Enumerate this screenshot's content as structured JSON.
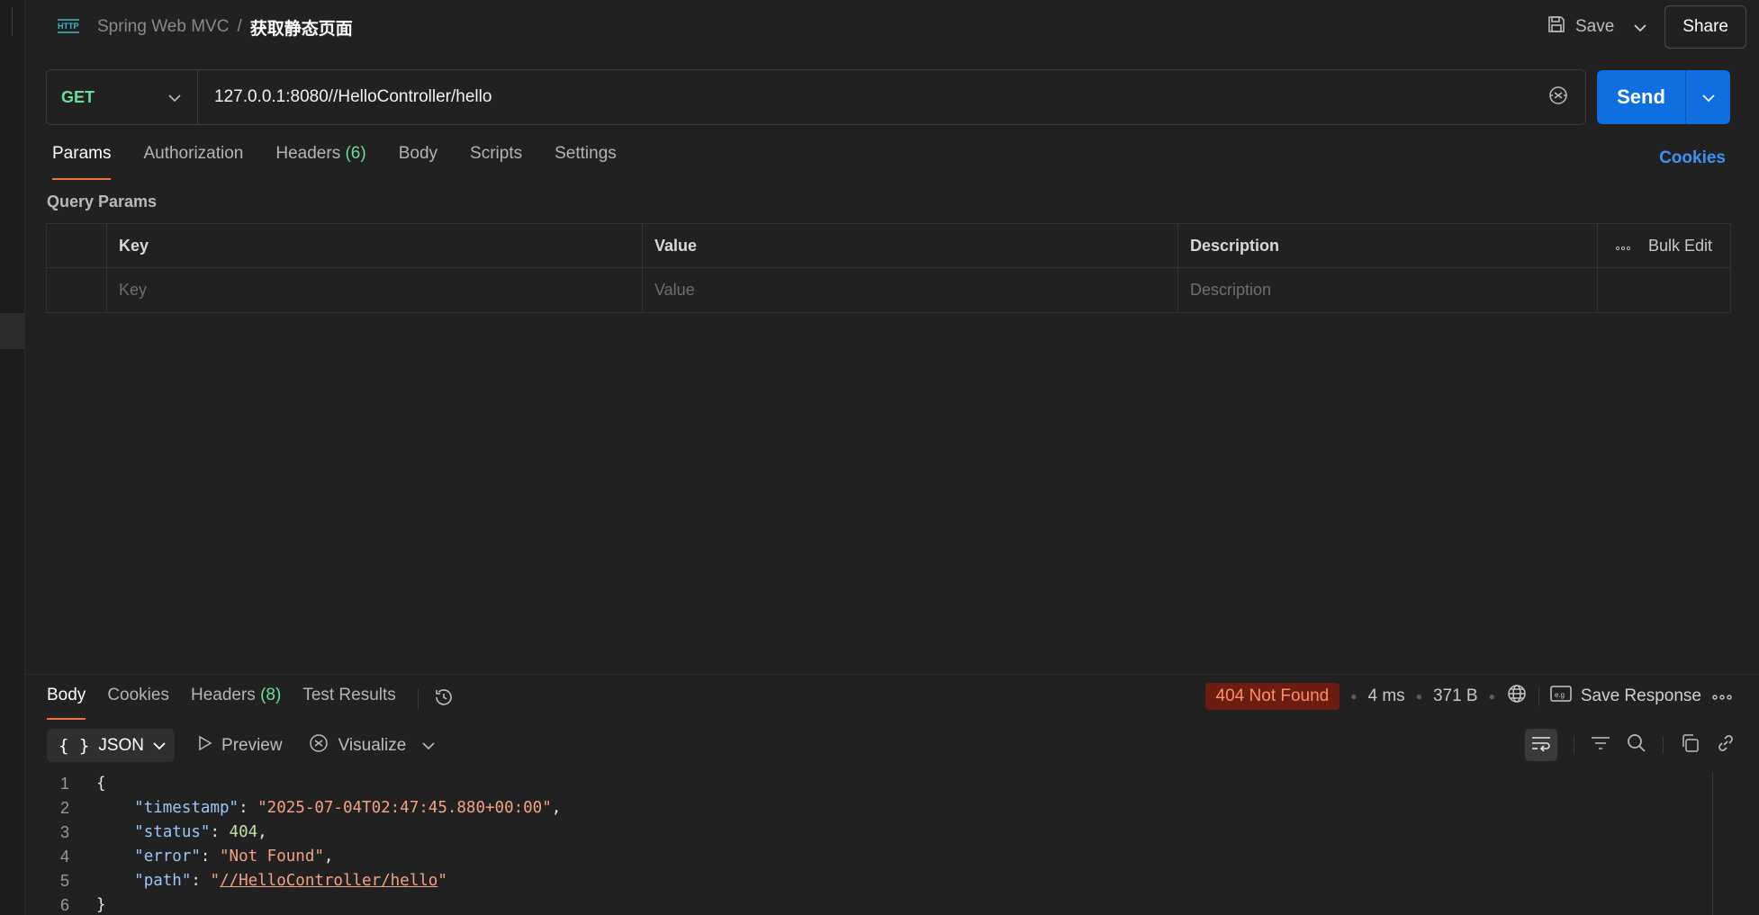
{
  "header": {
    "icon": "http-request-icon",
    "collection": "Spring Web MVC",
    "separator": "/",
    "request_name": "获取静态页面",
    "save_label": "Save",
    "share_label": "Share"
  },
  "request": {
    "method": "GET",
    "url": "127.0.0.1:8080//HelloController/hello",
    "send_label": "Send"
  },
  "request_tabs": [
    {
      "label": "Params",
      "count": "",
      "active": true
    },
    {
      "label": "Authorization",
      "count": "",
      "active": false
    },
    {
      "label": "Headers",
      "count": "(6)",
      "active": false
    },
    {
      "label": "Body",
      "count": "",
      "active": false
    },
    {
      "label": "Scripts",
      "count": "",
      "active": false
    },
    {
      "label": "Settings",
      "count": "",
      "active": false
    }
  ],
  "cookies_link": "Cookies",
  "query_params": {
    "title": "Query Params",
    "columns": [
      "Key",
      "Value",
      "Description"
    ],
    "bulk_edit": "Bulk Edit",
    "placeholders": {
      "key": "Key",
      "value": "Value",
      "description": "Description"
    }
  },
  "response_tabs": [
    {
      "label": "Body",
      "count": "",
      "active": true
    },
    {
      "label": "Cookies",
      "count": "",
      "active": false
    },
    {
      "label": "Headers",
      "count": "(8)",
      "active": false
    },
    {
      "label": "Test Results",
      "count": "",
      "active": false
    }
  ],
  "response_meta": {
    "status": "404 Not Found",
    "time": "4 ms",
    "size": "371 B",
    "save_response": "Save Response",
    "status_color": "#6b1d10"
  },
  "response_toolbar": {
    "format": "JSON",
    "preview": "Preview",
    "visualize": "Visualize"
  },
  "response_body": {
    "line_numbers": [
      "1",
      "2",
      "3",
      "4",
      "5",
      "6"
    ],
    "open_brace": "{",
    "close_brace": "}",
    "fields": [
      {
        "key": "\"timestamp\"",
        "value": "\"2025-07-04T02:47:45.880+00:00\"",
        "comma": ","
      },
      {
        "key": "\"status\"",
        "value": "404",
        "comma": ","
      },
      {
        "key": "\"error\"",
        "value": "\"Not Found\"",
        "comma": ","
      },
      {
        "key": "\"path\"",
        "value": "//HelloController/hello",
        "comma": ""
      }
    ]
  },
  "colors": {
    "accent": "#0f6fe0",
    "method_get": "#6bdd9a",
    "active_tab_underline": "#f0743e",
    "link": "#3c92f4"
  }
}
